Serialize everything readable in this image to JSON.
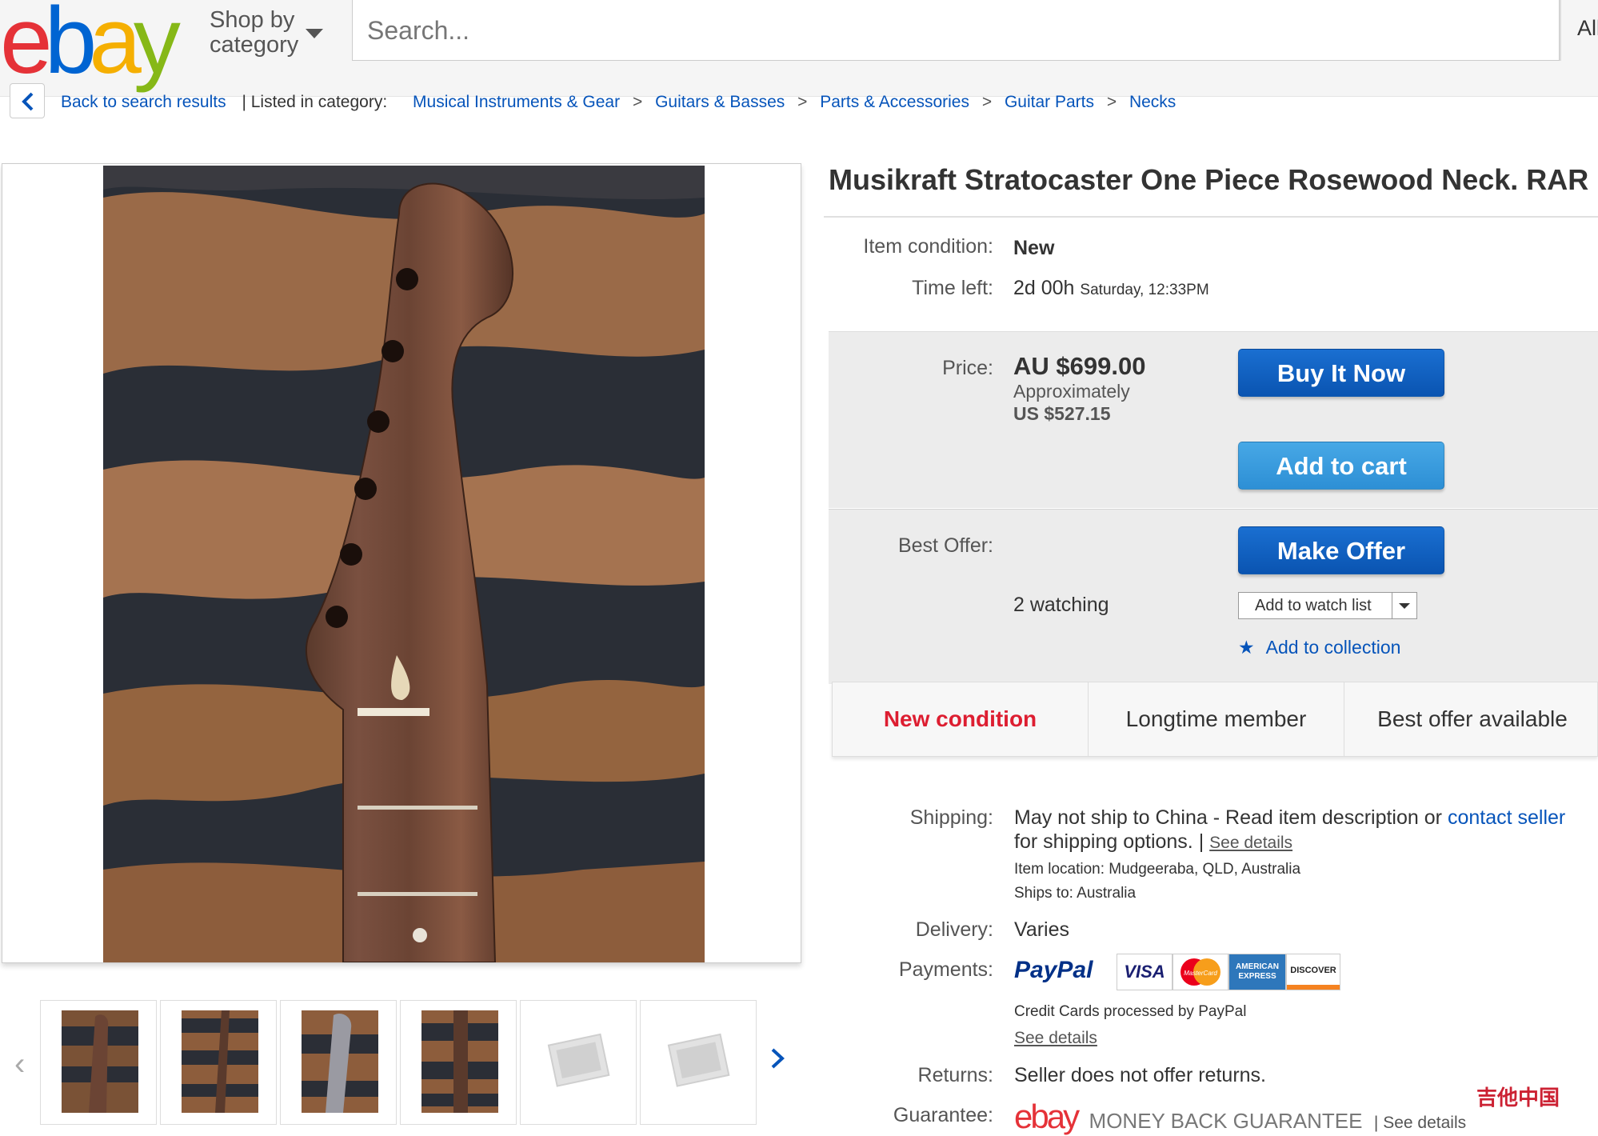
{
  "header": {
    "logo": [
      "e",
      "b",
      "a",
      "y"
    ],
    "logo_colors": [
      "#e53238",
      "#0064d2",
      "#f5af02",
      "#86b817"
    ],
    "shop_by_line1": "Shop by",
    "shop_by_line2": "category",
    "search_placeholder": "Search...",
    "category_select": "All"
  },
  "breadcrumb": {
    "back_label": "Back to search results",
    "listed_in": "| Listed in category:",
    "items": [
      "Musical Instruments & Gear",
      "Guitars & Basses",
      "Parts & Accessories",
      "Guitar Parts",
      "Necks"
    ],
    "separator": ">"
  },
  "listing": {
    "title": "Musikraft Stratocaster One Piece Rosewood Neck. RAR",
    "condition_label": "Item condition:",
    "condition_value": "New",
    "time_left_label": "Time left:",
    "time_left_value": "2d 00h",
    "time_left_end": "Saturday, 12:33PM"
  },
  "price": {
    "label": "Price:",
    "value": "AU $699.00",
    "approx_label": "Approximately",
    "approx_value": "US $527.15",
    "buy_now": "Buy It Now",
    "add_to_cart": "Add to cart"
  },
  "offer": {
    "label": "Best Offer:",
    "make_offer": "Make Offer",
    "watching": "2 watching",
    "watch_list": "Add to watch list",
    "add_collection": "Add to collection"
  },
  "features": [
    "New condition",
    "Longtime member",
    "Best offer available"
  ],
  "shipping": {
    "label": "Shipping:",
    "line1": "May not ship to China - Read item description or",
    "contact_link": "contact seller",
    "line2": "for shipping options. |",
    "see_details": "See details",
    "location": "Item location:  Mudgeeraba, QLD, Australia",
    "ships_to": "Ships to:  Australia"
  },
  "delivery": {
    "label": "Delivery:",
    "value": "Varies"
  },
  "payments": {
    "label": "Payments:",
    "paypal": "PayPal",
    "cards": [
      "VISA",
      "MasterCard",
      "AMERICAN EXPRESS",
      "DISCOVER"
    ],
    "note": "Credit Cards processed by PayPal",
    "see_details": "See details"
  },
  "returns": {
    "label": "Returns:",
    "value": "Seller does not offer returns."
  },
  "guarantee": {
    "label": "Guarantee:",
    "logo": "ebay",
    "text": "MONEY BACK GUARANTEE",
    "see_details": "| See details"
  },
  "watermark": "吉他中国"
}
